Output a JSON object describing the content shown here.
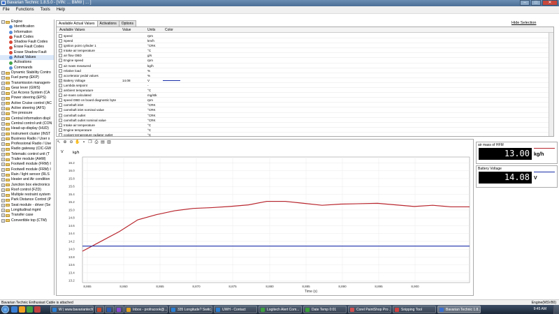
{
  "window": {
    "title": "Bavarian Technic 1.8.5.0 - [VIN: ... BMW | ... ]",
    "controls": [
      "minimize-icon",
      "maximize-icon",
      "close-icon"
    ]
  },
  "menu": [
    "File",
    "Functions",
    "Tools",
    "Help"
  ],
  "tree": {
    "root": {
      "label": "Engine",
      "expanded": true
    },
    "children": [
      {
        "label": "Identification",
        "icon": "info"
      },
      {
        "label": "Information",
        "icon": "info"
      },
      {
        "label": "Fault Codes",
        "icon": "fault"
      },
      {
        "label": "Shadow Fault Codes",
        "icon": "fault"
      },
      {
        "label": "Erase Fault Codes",
        "icon": "erase"
      },
      {
        "label": "Erase Shadow Fault",
        "icon": "erase"
      },
      {
        "label": "Actual Values",
        "icon": "values"
      },
      {
        "label": "Activations",
        "icon": "activation"
      },
      {
        "label": "Commands",
        "icon": "command"
      }
    ],
    "modules": [
      "Dynamic Stability Contro",
      "Fuel pump (EKP)",
      "Transmission managem-",
      "Gear lever (GWS)",
      "Car Access System (CA",
      "Power steering (EPS)",
      "Active Cruise control (AC",
      "Active steering (AFS)",
      "Tire pressure",
      "Central information displ",
      "Central control unit (CON",
      "Head-up-display (HUD)",
      "Instrument cluster (INST",
      "Business Radio / User s",
      "Professional Radio / Use",
      "Radio gateway (CIC-GW",
      "Telematic control unit (T",
      "Trailer module (AHM)",
      "Footwell module (FRM) I",
      "Footwell module (FRM) I",
      "Rain / light sensor (RLS",
      "Heater and Air condition",
      "Junction box electronics",
      "Roof control (FZD)",
      "Multiple restraint system",
      "Park Distance Control (P",
      "Seat module - driver (Se",
      "Longitudinal mgmt",
      "Transfer case",
      "Convertible top (CTM)"
    ]
  },
  "tabs": [
    "Available Actual Values",
    "Activations",
    "Options"
  ],
  "hide_selection": "Hide Selection",
  "values_table": {
    "headers": [
      "Available Values",
      "Value",
      "Units",
      "Color"
    ],
    "rows": [
      {
        "name": "speed",
        "value": "",
        "unit": "rpm",
        "checked": false
      },
      {
        "name": "Speed",
        "value": "",
        "unit": "km/h",
        "checked": false
      },
      {
        "name": "ignition point cylinder 1",
        "value": "",
        "unit": "°CRK",
        "checked": false
      },
      {
        "name": "Intake air temperature",
        "value": "",
        "unit": "°C",
        "checked": false
      },
      {
        "name": "air flow OBD",
        "value": "",
        "unit": "g/s",
        "checked": false
      },
      {
        "name": "Engine speed",
        "value": "",
        "unit": "rpm",
        "checked": false
      },
      {
        "name": "air mass measured",
        "value": "",
        "unit": "kg/h",
        "checked": false
      },
      {
        "name": "relative load",
        "value": "",
        "unit": "%",
        "checked": false
      },
      {
        "name": "accelerator pedal values",
        "value": "",
        "unit": "%",
        "checked": false
      },
      {
        "name": "Battery Voltage",
        "value": "14.08",
        "unit": "V",
        "checked": true,
        "color": "#1a2ea8"
      },
      {
        "name": "Lambda setpoint",
        "value": "",
        "unit": "-",
        "checked": false
      },
      {
        "name": "ambient temperature",
        "value": "",
        "unit": "°C",
        "checked": false
      },
      {
        "name": "air-mass calculated",
        "value": "",
        "unit": "mg/stk",
        "checked": false
      },
      {
        "name": "speed OBD on board diagnostic byte",
        "value": "",
        "unit": "rpm",
        "checked": false
      },
      {
        "name": "camshaft inlet",
        "value": "",
        "unit": "°CRK",
        "checked": false
      },
      {
        "name": "camshaft inlet nominal value",
        "value": "",
        "unit": "°CRK",
        "checked": false
      },
      {
        "name": "camshaft outlet",
        "value": "",
        "unit": "°CRK",
        "checked": false
      },
      {
        "name": "camshaft outlet nominal value",
        "value": "",
        "unit": "°CRK",
        "checked": false
      },
      {
        "name": "Intake air temperature",
        "value": "",
        "unit": "°C",
        "checked": false
      },
      {
        "name": "Engine temperature",
        "value": "",
        "unit": "°C",
        "checked": false
      },
      {
        "name": "coolant temperature radiator outlet",
        "value": "",
        "unit": "°C",
        "checked": false
      }
    ]
  },
  "chart_toolbar": [
    "arrow-icon",
    "zoom-in-icon",
    "zoom-out-icon",
    "pan-icon",
    "save-icon",
    "copy-icon",
    "print-icon",
    "open-icon",
    "export-icon"
  ],
  "chart_data": {
    "type": "line",
    "xlabel": "Time (s)",
    "y_left_unit": "V",
    "y_right_unit": "kg/h",
    "x_ticks": [
      8865,
      8860,
      8865,
      8870,
      8875,
      8880,
      8885,
      8890,
      8895,
      8900
    ],
    "x_tick_labels": [
      "8,865",
      "8,860",
      "8,865",
      "8,870",
      "8,875",
      "8,880",
      "8,885",
      "8,890",
      "8,895",
      "8,900"
    ],
    "xlim": [
      8861,
      8903
    ],
    "y_ticks": [
      13.2,
      13.4,
      13.6,
      13.8,
      14.0,
      14.2,
      14.4,
      14.6,
      14.8,
      15.0,
      15.2,
      15.4,
      15.6,
      15.8,
      16.0,
      16.2
    ],
    "y2_ticks": [
      12.0,
      12.2,
      12.4,
      12.6,
      12.8,
      13.0,
      13.2,
      13.4,
      13.6,
      13.8,
      14.0
    ],
    "ylim": [
      13.15,
      16.35
    ],
    "y2lim": [
      11.05,
      14.25
    ],
    "series": [
      {
        "name": "air mass of HFM",
        "color": "#b8262e",
        "axis": "right",
        "x": [
          8861,
          8863,
          8865,
          8867,
          8869,
          8871,
          8873,
          8875,
          8877,
          8879,
          8881,
          8883,
          8885,
          8887,
          8889,
          8891,
          8893,
          8895,
          8897,
          8899,
          8901,
          8903
        ],
        "y": [
          11.85,
          12.1,
          12.35,
          12.65,
          12.78,
          12.88,
          12.94,
          12.96,
          12.99,
          13.03,
          13.12,
          13.12,
          13.07,
          13.02,
          13.05,
          13.06,
          13.07,
          13.03,
          12.99,
          13.02,
          12.98,
          12.98
        ]
      },
      {
        "name": "Battery Voltage",
        "color": "#1a2ea8",
        "axis": "left",
        "x": [
          8861,
          8862,
          8863,
          8864,
          8865,
          8866,
          8867,
          8868,
          8869,
          8870,
          8871,
          8872,
          8873,
          8874,
          8875,
          8876,
          8877,
          8878,
          8879,
          8880,
          8881,
          8882,
          8883,
          8884,
          8885,
          8886,
          8887,
          8888,
          8889,
          8890,
          8891,
          8892,
          8893,
          8894,
          8895,
          8896,
          8897,
          8898,
          8899,
          8900,
          8901,
          8902,
          8903
        ],
        "y": [
          14.08,
          14.08,
          14.08,
          14.08,
          14.08,
          14.08,
          14.08,
          14.08,
          14.08,
          14.08,
          14.08,
          14.08,
          14.08,
          14.08,
          14.08,
          14.08,
          14.08,
          14.08,
          14.08,
          14.08,
          14.08,
          14.08,
          14.08,
          14.08,
          14.08,
          14.08,
          14.08,
          14.08,
          14.08,
          14.08,
          14.08,
          14.08,
          14.08,
          14.08,
          14.08,
          14.08,
          14.08,
          14.08,
          14.08,
          14.08,
          14.08,
          14.08,
          14.08
        ]
      }
    ]
  },
  "readouts": [
    {
      "label": "air mass of HFM",
      "value": "13.00",
      "unit": "kg/h",
      "color": "#b8262e"
    },
    {
      "label": "Battery Voltage",
      "value": "14.08",
      "unit": "V",
      "color": "#1a2ea8"
    }
  ],
  "status": {
    "left": "Bavarian Technic Enthusiast Cable is attached",
    "right": "Engine(MSV80)"
  },
  "taskbar": {
    "buttons": [
      {
        "label": "W | www.bavariantechni...",
        "color": "#2a7fd4"
      },
      {
        "label": "",
        "color": "#c94a2c"
      },
      {
        "label": "",
        "color": "#2a5db8"
      },
      {
        "label": "",
        "color": "#8a4ad0"
      },
      {
        "label": "Inbox - profracook@...",
        "color": "#e0a020"
      },
      {
        "label": "335 Longitude? Switc...",
        "color": "#2a7fd4"
      },
      {
        "label": "UWH - Contact",
        "color": "#2a7fd4"
      },
      {
        "label": "Logitech Alert Com...",
        "color": "#40a040"
      },
      {
        "label": "Date Temp 0:01",
        "color": "#38a038"
      },
      {
        "label": "Corel PaintShop Pro ...",
        "color": "#d05050"
      },
      {
        "label": "Snipping Tool",
        "color": "#d04040"
      },
      {
        "label": "Bavarian Technic 1.8...",
        "color": "#3a6fd0"
      }
    ],
    "clock": "9:45 AM"
  }
}
